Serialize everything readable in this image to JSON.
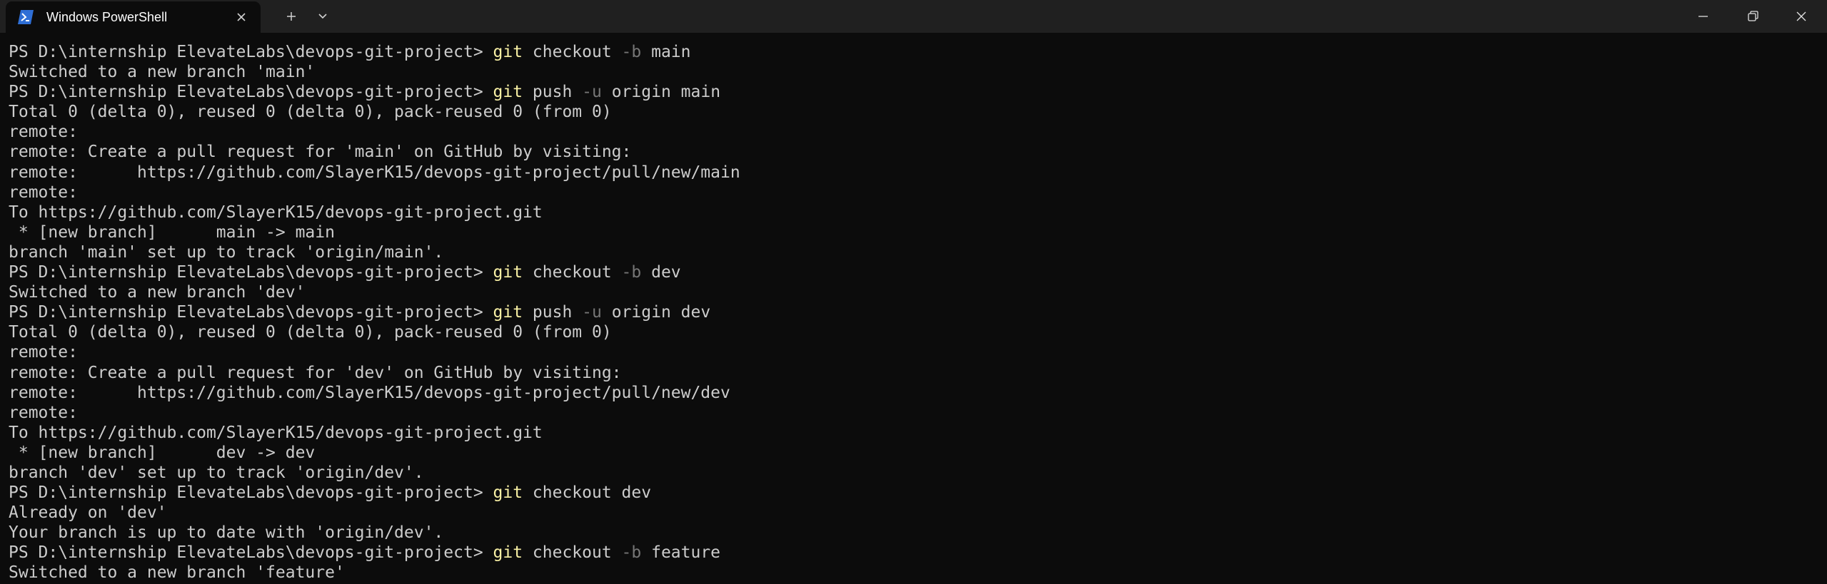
{
  "window": {
    "tab_title": "Windows PowerShell",
    "tab_icon": "powershell-icon",
    "buttons": {
      "tab_close": "close-icon",
      "new_tab": "plus-icon",
      "tab_dropdown": "chevron-down-icon",
      "minimize": "minimize-icon",
      "restore": "restore-icon",
      "close": "close-icon"
    }
  },
  "colors": {
    "background": "#0c0c0c",
    "titlebar": "#202020",
    "text": "#cccccc",
    "command": "#f9f1a5",
    "parameter": "#767676"
  },
  "terminal": {
    "lines": [
      {
        "prompt": "PS D:\\internship ElevateLabs\\devops-git-project> ",
        "cmd": "git",
        "args": [
          {
            "t": "checkout "
          },
          {
            "t": "-b",
            "flag": true
          },
          {
            "t": " main"
          }
        ]
      },
      {
        "text": "Switched to a new branch 'main'"
      },
      {
        "prompt": "PS D:\\internship ElevateLabs\\devops-git-project> ",
        "cmd": "git",
        "args": [
          {
            "t": "push "
          },
          {
            "t": "-u",
            "flag": true
          },
          {
            "t": " origin main"
          }
        ]
      },
      {
        "text": "Total 0 (delta 0), reused 0 (delta 0), pack-reused 0 (from 0)"
      },
      {
        "text": "remote:"
      },
      {
        "text": "remote: Create a pull request for 'main' on GitHub by visiting:"
      },
      {
        "text": "remote:      https://github.com/SlayerK15/devops-git-project/pull/new/main"
      },
      {
        "text": "remote:"
      },
      {
        "text": "To https://github.com/SlayerK15/devops-git-project.git"
      },
      {
        "text": " * [new branch]      main -> main"
      },
      {
        "text": "branch 'main' set up to track 'origin/main'."
      },
      {
        "prompt": "PS D:\\internship ElevateLabs\\devops-git-project> ",
        "cmd": "git",
        "args": [
          {
            "t": "checkout "
          },
          {
            "t": "-b",
            "flag": true
          },
          {
            "t": " dev"
          }
        ]
      },
      {
        "text": "Switched to a new branch 'dev'"
      },
      {
        "prompt": "PS D:\\internship ElevateLabs\\devops-git-project> ",
        "cmd": "git",
        "args": [
          {
            "t": "push "
          },
          {
            "t": "-u",
            "flag": true
          },
          {
            "t": " origin dev"
          }
        ]
      },
      {
        "text": "Total 0 (delta 0), reused 0 (delta 0), pack-reused 0 (from 0)"
      },
      {
        "text": "remote:"
      },
      {
        "text": "remote: Create a pull request for 'dev' on GitHub by visiting:"
      },
      {
        "text": "remote:      https://github.com/SlayerK15/devops-git-project/pull/new/dev"
      },
      {
        "text": "remote:"
      },
      {
        "text": "To https://github.com/SlayerK15/devops-git-project.git"
      },
      {
        "text": " * [new branch]      dev -> dev"
      },
      {
        "text": "branch 'dev' set up to track 'origin/dev'."
      },
      {
        "prompt": "PS D:\\internship ElevateLabs\\devops-git-project> ",
        "cmd": "git",
        "args": [
          {
            "t": "checkout dev"
          }
        ]
      },
      {
        "text": "Already on 'dev'"
      },
      {
        "text": "Your branch is up to date with 'origin/dev'."
      },
      {
        "prompt": "PS D:\\internship ElevateLabs\\devops-git-project> ",
        "cmd": "git",
        "args": [
          {
            "t": "checkout "
          },
          {
            "t": "-b",
            "flag": true
          },
          {
            "t": " feature"
          }
        ]
      },
      {
        "text": "Switched to a new branch 'feature'"
      }
    ]
  }
}
